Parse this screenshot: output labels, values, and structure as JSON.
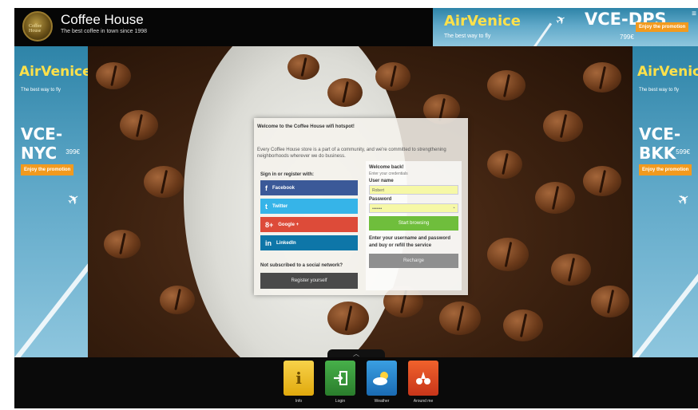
{
  "header": {
    "logo_text": "Coffee House",
    "title": "Coffee House",
    "subtitle": "The best coffee in town since 1998"
  },
  "ads": {
    "top": {
      "brand": "AirVenice",
      "tagline": "The best way to fly",
      "route": "VCE-DPS",
      "price": "799€",
      "promo": "Enjoy the promotion"
    },
    "left": {
      "brand": "AirVenice",
      "tagline": "The best way to fly",
      "route": "VCE-NYC",
      "price": "399€",
      "promo": "Enjoy the promotion"
    },
    "right": {
      "brand": "AirVenice",
      "tagline": "The best way to fly",
      "route": "VCE-BKK",
      "price": "599€",
      "promo": "Enjoy the promotion"
    }
  },
  "login": {
    "heading": "Welcome to the Coffee House wifi hotspot!",
    "intro": "Every Coffee House store is a part of a community, and we're committed to strengthening neighborhoods wherever we do business.",
    "social_label": "Sign in or register with:",
    "social": [
      {
        "label": "Facebook",
        "icon": "f"
      },
      {
        "label": "Twitter",
        "icon": "t"
      },
      {
        "label": "Google +",
        "icon": "8+"
      },
      {
        "label": "LinkedIn",
        "icon": "in"
      }
    ],
    "not_subscribed": "Not subscribed to a social network?",
    "register_button": "Register yourself",
    "welcome_back": "Welcome back!",
    "enter_credentials": "Enter your credentials",
    "username_label": "User name",
    "username_value": "Robert",
    "password_label": "Password",
    "password_value": "•••••••",
    "start_button": "Start browsing",
    "recharge_text": "Enter your username and password and buy or refill the service",
    "recharge_button": "Recharge"
  },
  "dock": {
    "items": [
      {
        "label": "Info",
        "icon": "i"
      },
      {
        "label": "Login",
        "icon": "login-icon"
      },
      {
        "label": "Weather",
        "icon": "weather-icon"
      },
      {
        "label": "Around me",
        "icon": "around-me-icon"
      }
    ]
  }
}
